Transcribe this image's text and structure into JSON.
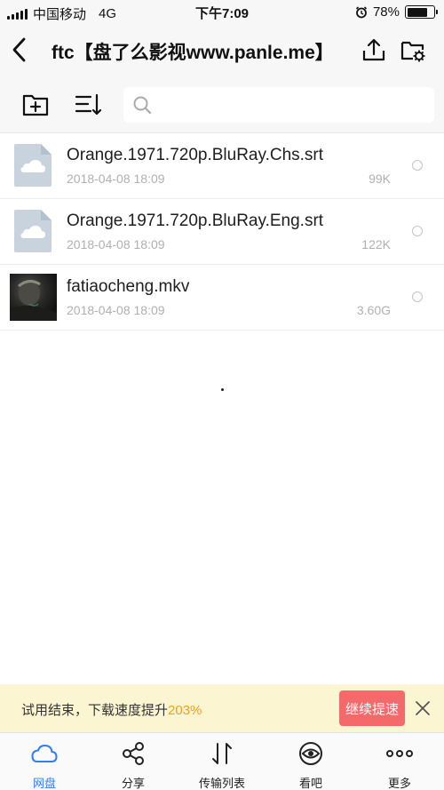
{
  "status_bar": {
    "carrier": "中国移动",
    "network": "4G",
    "time": "下午7:09",
    "battery_text": "78%",
    "battery_level": 0.78
  },
  "header": {
    "title": "ftc【盘了么影视www.panle.me】"
  },
  "files": [
    {
      "name": "Orange.1971.720p.BluRay.Chs.srt",
      "date": "2018-04-08 18:09",
      "size": "99K",
      "type": "document",
      "icon": "cloud-file-icon"
    },
    {
      "name": "Orange.1971.720p.BluRay.Eng.srt",
      "date": "2018-04-08 18:09",
      "size": "122K",
      "type": "document",
      "icon": "cloud-file-icon"
    },
    {
      "name": "fatiaocheng.mkv",
      "date": "2018-04-08 18:09",
      "size": "3.60G",
      "type": "video",
      "icon": "video-thumbnail"
    }
  ],
  "promo": {
    "text": "试用结束，下载速度提升",
    "percent": "203%",
    "button_label": "继续提速"
  },
  "tabs": [
    {
      "label": "网盘",
      "icon": "cloud-icon",
      "active": true
    },
    {
      "label": "分享",
      "icon": "share-icon",
      "active": false
    },
    {
      "label": "传输列表",
      "icon": "transfer-icon",
      "active": false
    },
    {
      "label": "看吧",
      "icon": "eye-icon",
      "active": false
    },
    {
      "label": "更多",
      "icon": "more-icon",
      "active": false
    }
  ],
  "colors": {
    "accent": "#2f7df4",
    "promo_button": "#f46a6a",
    "promo_bg": "#fcf5d2",
    "promo_highlight": "#f0a020",
    "file_icon": "#c8d3de"
  }
}
